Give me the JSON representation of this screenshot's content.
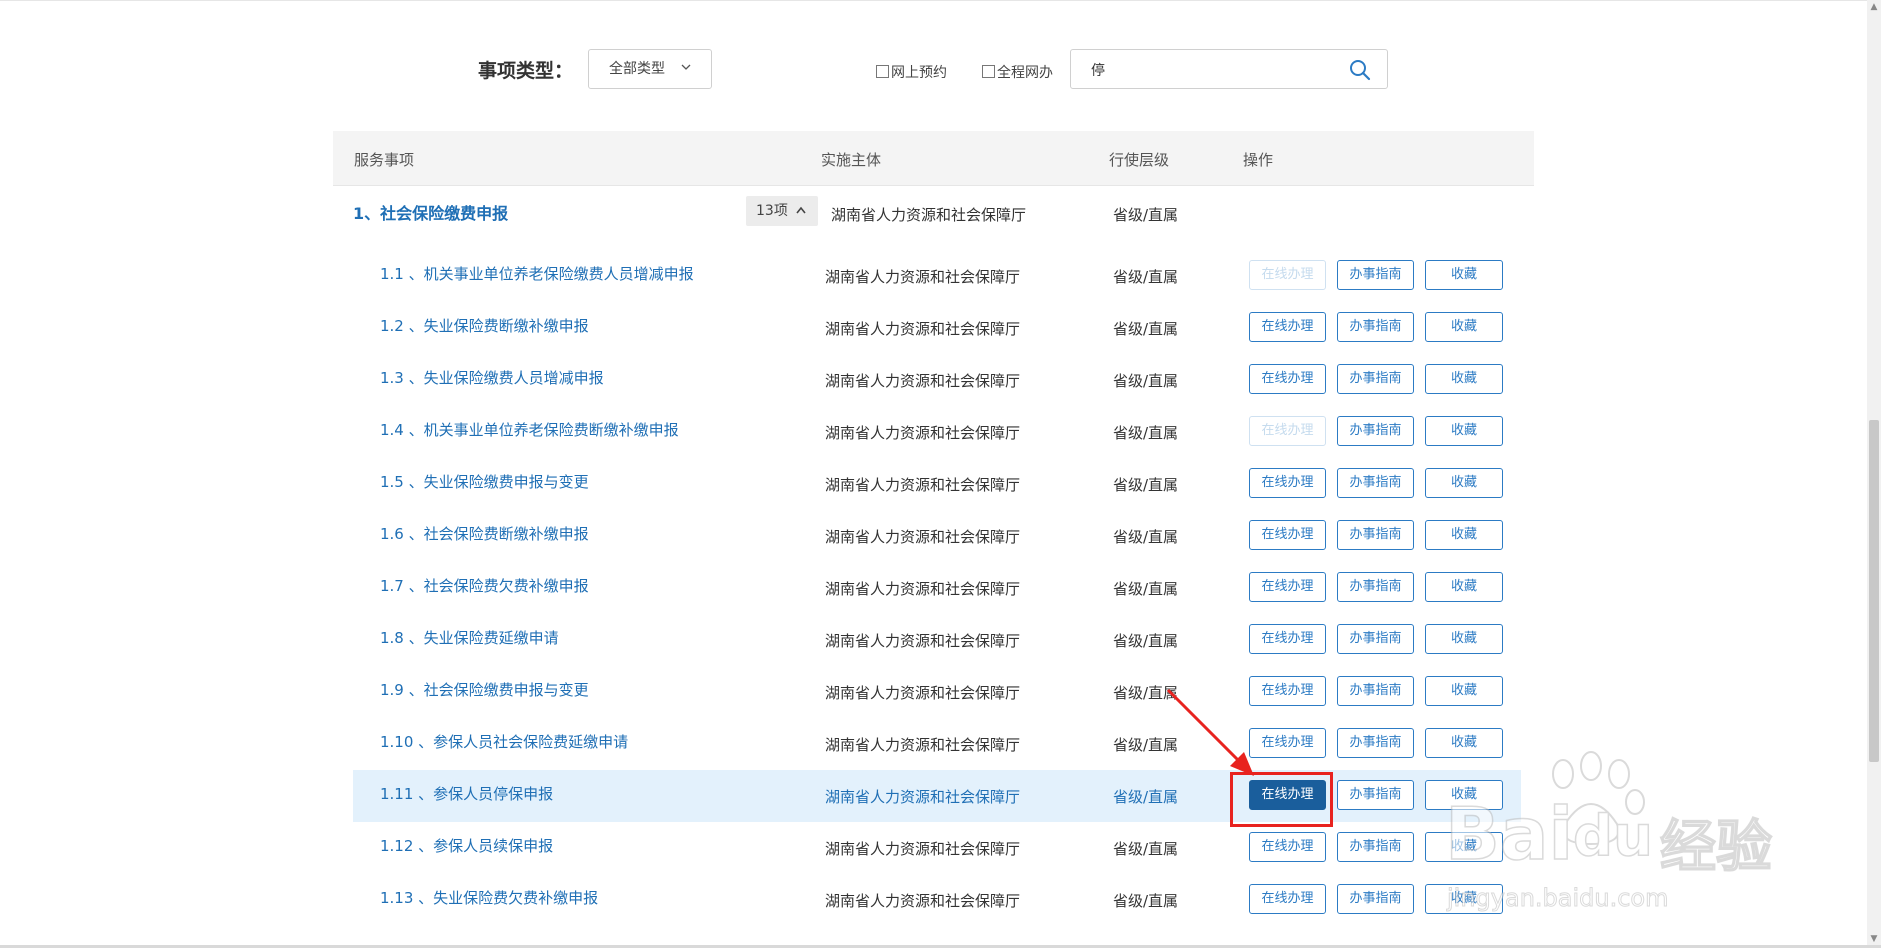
{
  "filter": {
    "label": "事项类型：",
    "type_select_value": "全部类型",
    "checkbox_online_booking": "网上预约",
    "checkbox_full_online": "全程网办",
    "search_value": "停"
  },
  "table": {
    "headers": [
      "服务事项",
      "实施主体",
      "行使层级",
      "操作"
    ],
    "group": {
      "title": "1、社会保险缴费申报",
      "count": "13项",
      "org": "湖南省人力资源和社会保障厅",
      "level": "省级/直属"
    },
    "buttons": {
      "online": "在线办理",
      "guide": "办事指南",
      "favorite": "收藏"
    },
    "rows": [
      {
        "name": "1.1 、机关事业单位养老保险缴费人员增减申报",
        "org": "湖南省人力资源和社会保障厅",
        "level": "省级/直属",
        "online_disabled": true
      },
      {
        "name": "1.2 、失业保险费断缴补缴申报",
        "org": "湖南省人力资源和社会保障厅",
        "level": "省级/直属"
      },
      {
        "name": "1.3 、失业保险缴费人员增减申报",
        "org": "湖南省人力资源和社会保障厅",
        "level": "省级/直属"
      },
      {
        "name": "1.4 、机关事业单位养老保险费断缴补缴申报",
        "org": "湖南省人力资源和社会保障厅",
        "level": "省级/直属",
        "online_disabled": true
      },
      {
        "name": "1.5 、失业保险缴费申报与变更",
        "org": "湖南省人力资源和社会保障厅",
        "level": "省级/直属"
      },
      {
        "name": "1.6 、社会保险费断缴补缴申报",
        "org": "湖南省人力资源和社会保障厅",
        "level": "省级/直属"
      },
      {
        "name": "1.7 、社会保险费欠费补缴申报",
        "org": "湖南省人力资源和社会保障厅",
        "level": "省级/直属"
      },
      {
        "name": "1.8 、失业保险费延缴申请",
        "org": "湖南省人力资源和社会保障厅",
        "level": "省级/直属"
      },
      {
        "name": "1.9 、社会保险缴费申报与变更",
        "org": "湖南省人力资源和社会保障厅",
        "level": "省级/直属"
      },
      {
        "name": "1.10 、参保人员社会保险费延缴申请",
        "org": "湖南省人力资源和社会保障厅",
        "level": "省级/直属"
      },
      {
        "name": "1.11 、参保人员停保申报",
        "org": "湖南省人力资源和社会保障厅",
        "level": "省级/直属",
        "highlighted": true
      },
      {
        "name": "1.12 、参保人员续保申报",
        "org": "湖南省人力资源和社会保障厅",
        "level": "省级/直属"
      },
      {
        "name": "1.13 、失业保险费欠费补缴申报",
        "org": "湖南省人力资源和社会保障厅",
        "level": "省级/直属"
      }
    ]
  },
  "watermark": {
    "logo": "Baidu经验",
    "url": "jingyan.baidu.com"
  },
  "colors": {
    "link_blue": "#1f6fb5",
    "button_blue": "#2c7bc4",
    "active_button": "#1a5e9c",
    "highlight_row": "#e3f1fc",
    "annotation_red": "#e8231f"
  }
}
